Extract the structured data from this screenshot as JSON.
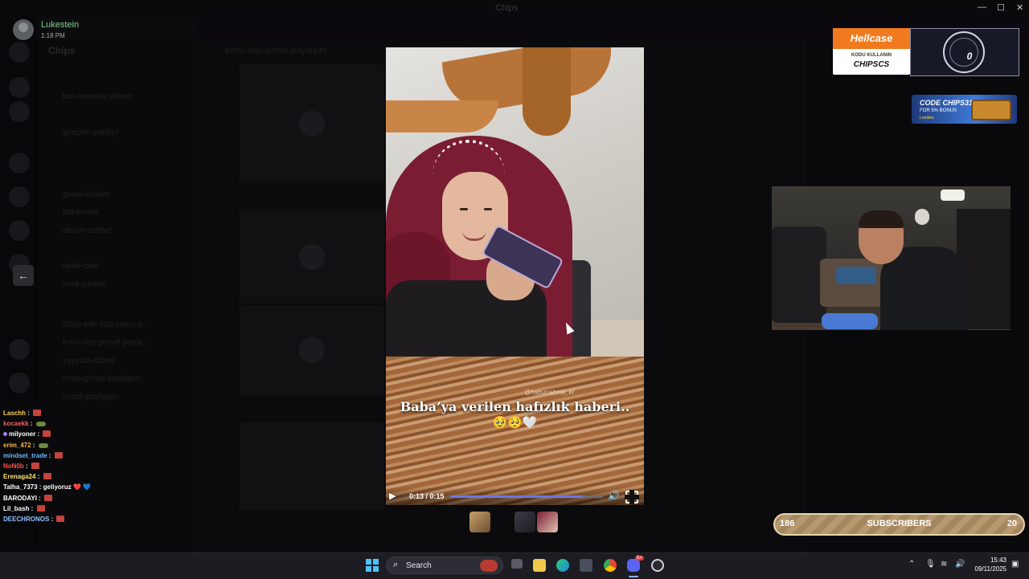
{
  "window": {
    "title": "Chips"
  },
  "discord": {
    "server_name": "Chips",
    "channels": [
      "ban-temotut-şikayet",
      "gençlim-çekiliş?",
      "genel-sohbet",
      "bot-komut",
      "albüm-sohbet",
      "radio-chat",
      "mod-sohbet",
      "chips-edit-foto-video-p...",
      "konu-dışı-görsel-payla...",
      "yayında-izlenir",
      "onun-görsel-paylaşım",
      "müzik-paylaşım"
    ],
    "chat_channel": "konu-dışı-görsel-paylaşım"
  },
  "popup": {
    "username": "Lukestein",
    "time": "1:18 PM",
    "back_icon": "arrow-left-icon"
  },
  "video": {
    "caption": "Baba’ya verilen hafızlık haberi..",
    "caption_emoji": "🥹🥺🤍",
    "watermark": "@haburrahme_kr",
    "time": "0:13 / 0:15",
    "progress": 0.87,
    "play_icon": "▶",
    "volume_icon": "🔊"
  },
  "overlay": {
    "hellcase_brand": "Hellcase",
    "hellcase_sub": "KODU KULLANIN",
    "hellcase_code": "CHIPSCS",
    "counter_value": "0",
    "lootbox_code": "CODE CHIPS31",
    "lootbox_bonus": "FOR 5% BONUS",
    "lootbox_brand": "Lootbox",
    "subs_left": "186",
    "subs_label": "SUBSCRIBERS",
    "subs_right": "20"
  },
  "stream_chat": [
    {
      "user": "Laschh",
      "color": "#ffd54a",
      "msg": "",
      "emote": "red"
    },
    {
      "user": "kocaekk",
      "color": "#ff5a5a",
      "msg": "",
      "emote": "green"
    },
    {
      "user": "milyoner",
      "color": "#ffffff",
      "msg": "",
      "emote": "red",
      "badge": true
    },
    {
      "user": "erim_472",
      "color": "#ffb54a",
      "msg": "",
      "emote": "green"
    },
    {
      "user": "mindset_trade",
      "color": "#6fb6ff",
      "msg": "",
      "emote": "red"
    },
    {
      "user": "NoN0b",
      "color": "#ff4f4f",
      "msg": "",
      "emote": "red"
    },
    {
      "user": "Erenaga24",
      "color": "#ffe26a",
      "msg": "",
      "emote": "red"
    },
    {
      "user": "Talha_7373",
      "color": "#ffffff",
      "msg": "geliyoruz ❤️ 💙",
      "emote": ""
    },
    {
      "user": "BARODAYI",
      "color": "#ffffff",
      "msg": "",
      "emote": "red"
    },
    {
      "user": "Lil_bash",
      "color": "#ffffff",
      "msg": "",
      "emote": "red"
    },
    {
      "user": "DEECHRONOS",
      "color": "#8fc2ff",
      "msg": "",
      "emote": "red"
    }
  ],
  "taskbar": {
    "search_placeholder": "Search",
    "time": "15:43",
    "date": "09/11/2025",
    "discord_badge": "5+"
  }
}
